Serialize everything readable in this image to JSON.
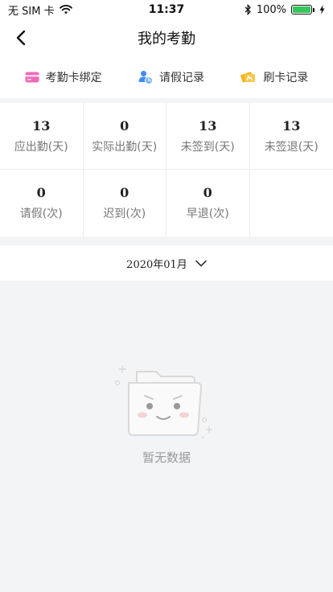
{
  "status_bar": {
    "carrier": "无 SIM 卡",
    "time": "11:37",
    "battery": "100%",
    "icons": [
      "wifi-icon",
      "bluetooth-icon",
      "battery-icon",
      "charging-icon"
    ],
    "battery_color": "#34c759"
  },
  "nav": {
    "title": "我的考勤",
    "back_icon": "chevron-left-icon"
  },
  "shortcuts": [
    {
      "label": "考勤卡绑定",
      "icon": "card-icon",
      "color": "#f06ab7"
    },
    {
      "label": "请假记录",
      "icon": "person-clock-icon",
      "color": "#3f8ef5"
    },
    {
      "label": "刷卡记录",
      "icon": "card-swipe-icon",
      "color": "#f5b21d"
    }
  ],
  "stats": [
    {
      "value": "13",
      "label": "应出勤(天)"
    },
    {
      "value": "0",
      "label": "实际出勤(天)"
    },
    {
      "value": "13",
      "label": "未签到(天)"
    },
    {
      "value": "13",
      "label": "未签退(天)"
    },
    {
      "value": "0",
      "label": "请假(次)"
    },
    {
      "value": "0",
      "label": "迟到(次)"
    },
    {
      "value": "0",
      "label": "早退(次)"
    }
  ],
  "month": {
    "value": "2020年01月",
    "icon": "chevron-down-icon"
  },
  "empty": {
    "text": "暂无数据",
    "icon": "empty-folder-icon"
  }
}
